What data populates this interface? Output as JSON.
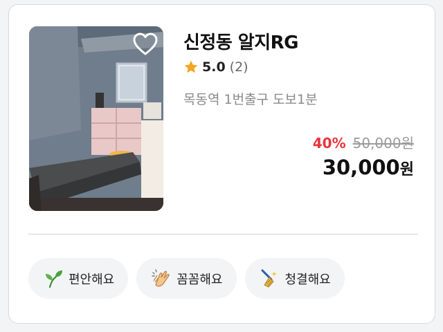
{
  "listing": {
    "title": "신정동 알지RG",
    "rating": {
      "score": "5.0",
      "count": "(2)"
    },
    "location": "목동역 1번출구 도보1분",
    "price": {
      "discount": "40%",
      "original": "50,000원",
      "final_amount": "30,000",
      "final_unit": "원"
    },
    "favorited": false,
    "tags": [
      {
        "label": "편안해요",
        "icon": "seedling-icon"
      },
      {
        "label": "꼼꼼해요",
        "icon": "clapping-hands-icon"
      },
      {
        "label": "청결해요",
        "icon": "broom-icon"
      }
    ]
  },
  "colors": {
    "discount": "#e8343d",
    "star": "#f6a623",
    "tag_background": "#f3f4f6"
  }
}
